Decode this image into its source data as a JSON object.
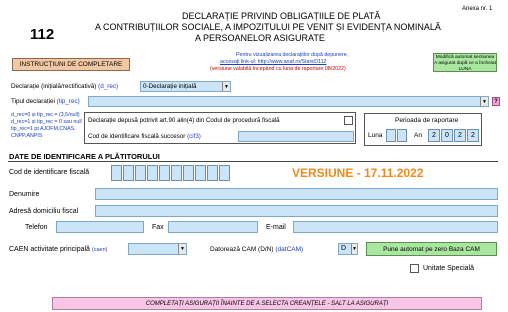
{
  "header": {
    "form_number": "112",
    "annex": "Anexa nr. 1",
    "title_line1": "DECLARAȚIE PRIVIND OBLIGAȚIILE DE PLATĂ",
    "title_line2": "A CONTRIBUȚIILOR SOCIALE, A IMPOZITULUI PE VENIT ȘI EVIDENȚA NOMINALĂ",
    "title_line3": "A PERSOANELOR ASIGURATE",
    "info_line1": "Pentru vizualizarea declarațiilor după depunere,",
    "info_line2": "accesați link-ul: http://www.anaf.ro/StareD112",
    "info_line3": "(versiune valabilă începând cu luna de raportare 08/2022)",
    "notice": "Modifică automat sectiunea A asigurat după ce a încheiat LUNA",
    "version": "VERSIUNE - 17.11.2022"
  },
  "toolbar": {
    "instructions_button": "INSTRUCȚIUNI DE COMPLETARE"
  },
  "declaration": {
    "type_label": "Declarație (inițială/rectificativă)",
    "type_code": "(d_rec)",
    "type_value": "0-Declarație inițială",
    "tip_label": "Tipul declarației",
    "tip_code": "(tip_rec)",
    "help_icon": "?",
    "codes_line1": "d_rec=0 și tip_rec = (3,5/null)",
    "codes_line2": "d_rec=1 și tip_rec = 0 sau null",
    "codes_line3": "tip_rec=1 pt AJOFM,CNAS,",
    "codes_line4": "CNPP,ANPIS",
    "art90_label": "Declarație depusă potrivit art.90 alin(4) din Codul de procedură fiscală",
    "successor_label": "Cod de identificare fiscală succesor",
    "successor_code": "(cif3)",
    "period_label": "Perioada de raportare",
    "luna_label": "Luna",
    "an_label": "An",
    "year_digits": [
      "2",
      "0",
      "2",
      "2"
    ]
  },
  "payer": {
    "section_title": "DATE DE IDENTIFICARE A PLĂTITORULUI",
    "cif_label": "Cod de identificare fiscală",
    "name_label": "Denumire",
    "address_label": "Adresă domiciliu fiscal",
    "phone_label": "Telefon",
    "fax_label": "Fax",
    "email_label": "E-mail",
    "caen_label": "CAEN activitate principală",
    "caen_code": "(caen)",
    "cam_label": "Datorează CAM (D/N)",
    "cam_code": "(datCAM)",
    "cam_value": "D",
    "cam_button": "Pune automat pe zero Baza CAM",
    "special_unit_label": "Unitate Specială"
  },
  "footer": {
    "banner": "COMPLETAȚI ASIGURAȚII ÎNAINTE DE A SELECTA CREANȚELE - SALT LA ASIGURAȚI"
  },
  "colors": {
    "field": "#cce4f7",
    "button": "#f4c7a3",
    "green_button": "#a9e6a0",
    "pink": "#f7c5e6",
    "version_orange": "#f08a1c"
  }
}
